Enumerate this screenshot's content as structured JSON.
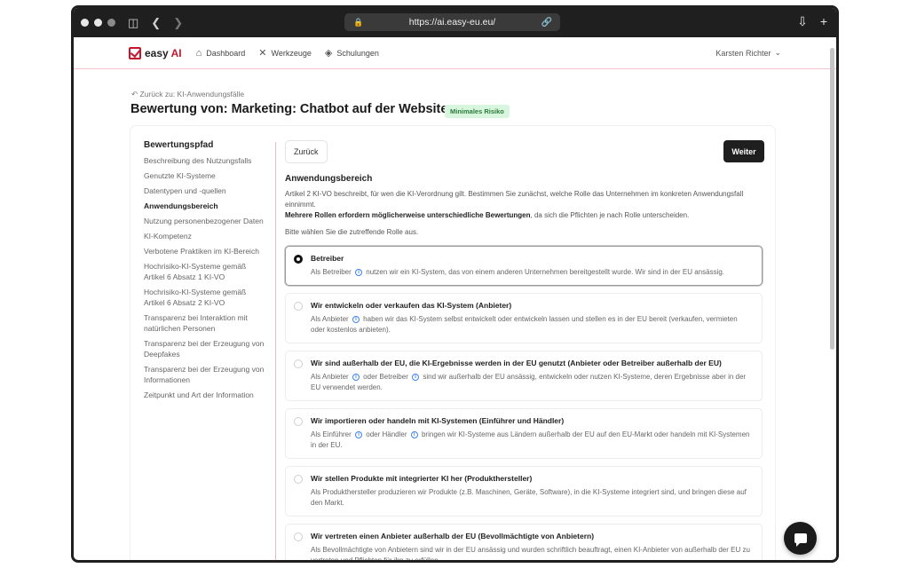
{
  "browser": {
    "url": "https://ai.easy-eu.eu/",
    "icons": [
      "sidebar-icon",
      "back-arrow-icon",
      "forward-arrow-icon",
      "lock-icon",
      "share-icon",
      "download-icon",
      "new-tab-icon"
    ]
  },
  "header": {
    "logo_text": "easy",
    "logo_ai": "AI",
    "nav": [
      {
        "label": "Dashboard",
        "icon": "home-icon"
      },
      {
        "label": "Werkzeuge",
        "icon": "tools-icon"
      },
      {
        "label": "Schulungen",
        "icon": "graduation-cap-icon"
      }
    ],
    "user": "Karsten Richter"
  },
  "page": {
    "back_link": "Zurück zu: KI-Anwendungsfälle",
    "title": "Bewertung von: Marketing: Chatbot auf der Website",
    "risk_badge": "Minimales Risiko"
  },
  "sidebar": {
    "title": "Bewertungspfad",
    "items": [
      "Beschreibung des Nutzungsfalls",
      "Genutzte KI-Systeme",
      "Datentypen und -quellen",
      "Anwendungsbereich",
      "Nutzung personenbezogener Daten",
      "KI-Kompetenz",
      "Verbotene Praktiken im KI-Bereich",
      "Hochrisiko-KI-Systeme gemäß Artikel 6 Absatz 1 KI-VO",
      "Hochrisiko-KI-Systeme gemäß Artikel 6 Absatz 2 KI-VO",
      "Transparenz bei Interaktion mit natürlichen Personen",
      "Transparenz bei der Erzeugung von Deepfakes",
      "Transparenz bei der Erzeugung von Informationen",
      "Zeitpunkt und Art der Information"
    ],
    "active": "Anwendungsbereich"
  },
  "main": {
    "back_button": "Zurück",
    "next_button": "Weiter",
    "section_title": "Anwendungsbereich",
    "intro_1": "Artikel 2 KI-VO beschreibt, für wen die KI-Verordnung gilt. Bestimmen Sie zunächst, welche Rolle das Unternehmen im konkreten Anwendungsfall einnimmt.",
    "intro_bold": "Mehrere Rollen erfordern möglicherweise unterschiedliche Bewertungen",
    "intro_2": ", da sich die Pflichten je nach Rolle unterscheiden.",
    "choose": "Bitte wählen Sie die zutreffende Rolle aus.",
    "options": [
      {
        "title": "Betreiber",
        "desc_a": "Als Betreiber",
        "desc_b": "nutzen wir ein KI-System, das von einem anderen Unternehmen bereitgestellt wurde. Wir sind in der EU ansässig."
      },
      {
        "title": "Wir entwickeln oder verkaufen das KI-System (Anbieter)",
        "desc_a": "Als Anbieter",
        "desc_b": "haben wir das KI-System selbst entwickelt oder entwickeln lassen und stellen es in der EU bereit (verkaufen, vermieten oder kostenlos anbieten)."
      },
      {
        "title": "Wir sind außerhalb der EU, die KI-Ergebnisse werden in der EU genutzt (Anbieter oder Betreiber außerhalb der EU)",
        "desc_a": "Als Anbieter",
        "desc_mid": "oder Betreiber",
        "desc_b": "sind wir außerhalb der EU ansässig, entwickeln oder nutzen KI-Systeme, deren Ergebnisse aber in der EU verwendet werden."
      },
      {
        "title": "Wir importieren oder handeln mit KI-Systemen (Einführer und Händler)",
        "desc_a": "Als Einführer",
        "desc_mid": "oder Händler",
        "desc_b": "bringen wir KI-Systeme aus Ländern außerhalb der EU auf den EU-Markt oder handeln mit KI-Systemen in der EU."
      },
      {
        "title": "Wir stellen Produkte mit integrierter KI her (Produkthersteller)",
        "desc_a": "Als Produkthersteller produzieren wir Produkte (z.B. Maschinen, Geräte, Software), in die KI-Systeme integriert sind, und bringen diese auf den Markt."
      },
      {
        "title": "Wir vertreten einen Anbieter außerhalb der EU (Bevollmächtigte von Anbietern)",
        "desc_a": "Als Bevollmächtigte von Anbietern sind wir in der EU ansässig und wurden schriftlich beauftragt, einen KI-Anbieter von außerhalb der EU zu vertreten und Pflichten für ihn zu erfüllen."
      }
    ],
    "selected_index": 0
  }
}
